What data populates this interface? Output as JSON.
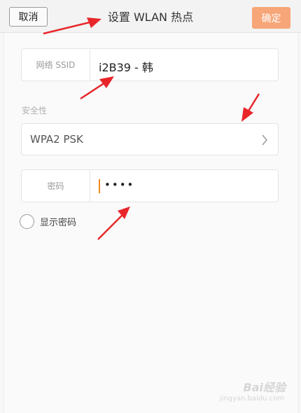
{
  "header": {
    "cancel_label": "取消",
    "title": "设置 WLAN 热点",
    "confirm_label": "确定"
  },
  "ssid": {
    "label": "网络 SSID",
    "value": "i2B39 - 韩"
  },
  "security": {
    "section_label": "安全性",
    "value": "WPA2 PSK"
  },
  "password": {
    "label": "密码",
    "value_masked": "••••"
  },
  "show_password": {
    "label": "显示密码",
    "checked": false
  },
  "watermark": {
    "text": "Bai经验",
    "url": "jingyan.baidu.com"
  },
  "colors": {
    "accent": "#f6a678",
    "cursor": "#f08a20",
    "annotation_arrow": "#e8262a"
  }
}
